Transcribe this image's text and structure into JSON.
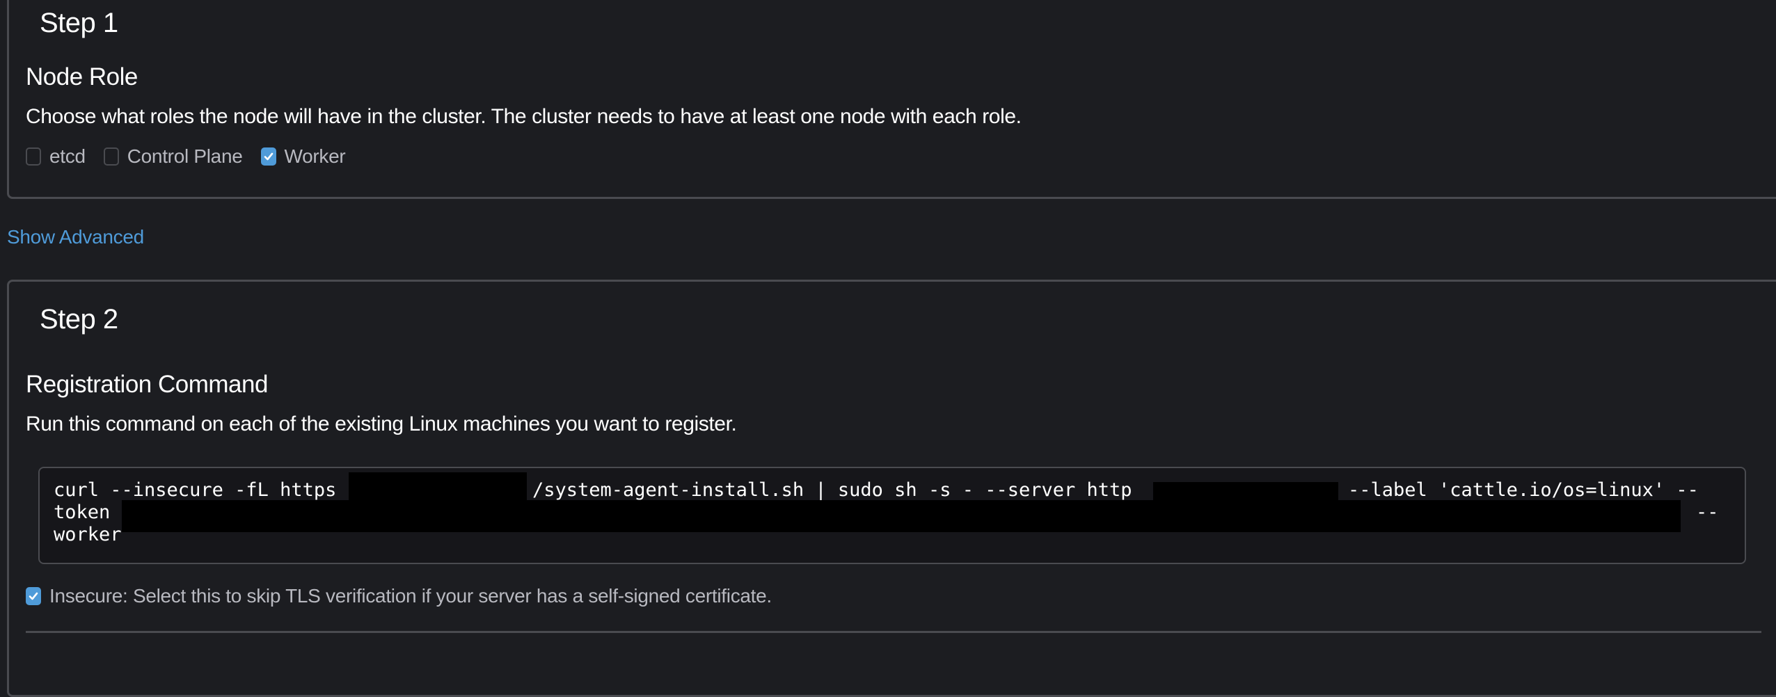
{
  "step1": {
    "title": "Step 1",
    "section_title": "Node Role",
    "description": "Choose what roles the node will have in the cluster. The cluster needs to have at least one node with each role.",
    "roles": [
      {
        "label": "etcd",
        "checked": false
      },
      {
        "label": "Control Plane",
        "checked": false
      },
      {
        "label": "Worker",
        "checked": true
      }
    ]
  },
  "show_advanced_label": "Show Advanced",
  "step2": {
    "title": "Step 2",
    "section_title": "Registration Command",
    "description": "Run this command on each of the existing Linux machines you want to register.",
    "command": {
      "line1_a": "curl --insecure -fL https",
      "line1_b": "/system-agent-install.sh | sudo sh -s - --server http",
      "line1_c": "--label 'cattle.io/os=linux' --",
      "line2_a": "token",
      "line2_b": "--",
      "line3_a": "worker",
      "redacted": true
    },
    "insecure": {
      "label": "Insecure: Select this to skip TLS verification if your server has a self-signed certificate.",
      "checked": true
    }
  },
  "colors": {
    "background": "#1c1d21",
    "border": "#4a4b50",
    "accent": "#4f9bd9",
    "code_bg": "#16161a",
    "muted_text": "#b8b9c0"
  }
}
